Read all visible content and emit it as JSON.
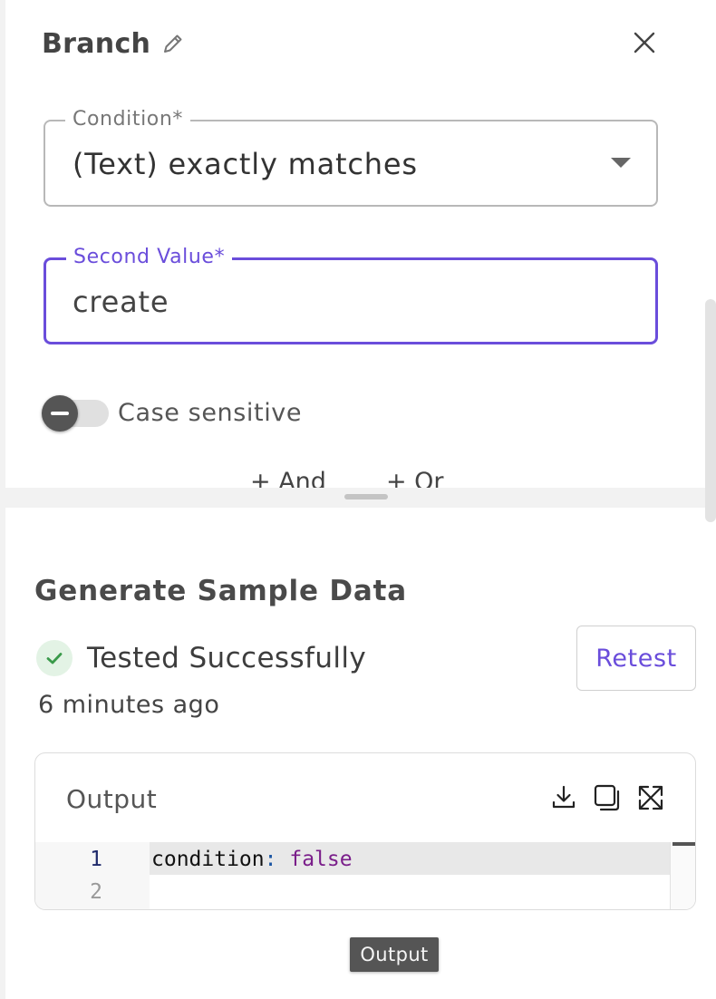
{
  "panel": {
    "title": "Branch",
    "condition_field": {
      "label": "Condition*",
      "value": "(Text) exactly matches"
    },
    "second_value_field": {
      "label": "Second Value*",
      "value": "create"
    },
    "case_sensitive": {
      "label": "Case sensitive",
      "enabled": false
    },
    "logic_buttons": {
      "and_label": "+ And",
      "or_label": "+ Or"
    }
  },
  "sample_data": {
    "title": "Generate Sample Data",
    "status": "Tested Successfully",
    "timestamp": "6 minutes ago",
    "retest_label": "Retest",
    "output": {
      "title": "Output",
      "lines": [
        {
          "number": "1",
          "key": "condition",
          "separator": ":",
          "value": "false"
        },
        {
          "number": "2"
        }
      ]
    }
  },
  "tooltip": {
    "text": "Output"
  },
  "colors": {
    "accent": "#6a4ddb",
    "success": "#3a9a4a",
    "text": "#333333"
  },
  "icons": [
    "pencil-icon",
    "close-icon",
    "chevron-down-icon",
    "check-circle-icon",
    "download-icon",
    "copy-icon",
    "expand-icon"
  ]
}
